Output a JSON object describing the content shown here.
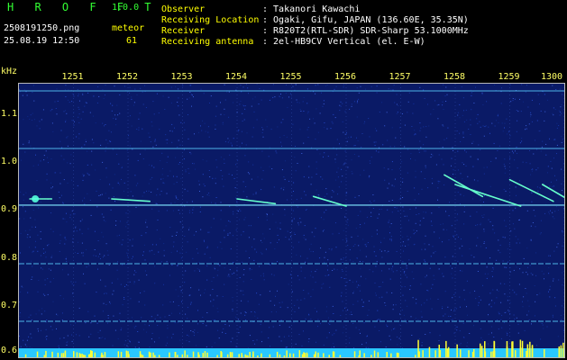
{
  "app": {
    "brand": "H R O F F T",
    "version": "1.0.0"
  },
  "file": {
    "name": "2508191250.png",
    "timestamp": "25.08.19 12:50"
  },
  "detector": {
    "label": "meteor",
    "count": "61"
  },
  "station": [
    {
      "key": "Observer",
      "value": ": Takanori Kawachi"
    },
    {
      "key": "Receiving Location",
      "value": ": Ogaki, Gifu, JAPAN (136.60E, 35.35N)"
    },
    {
      "key": "Receiver",
      "value": ": R820T2(RTL-SDR) SDR-Sharp 53.1000MHz"
    },
    {
      "key": "Receiving antenna",
      "value": ": 2el-HB9CV Vertical (el. E-W)"
    }
  ],
  "colors": {
    "accent": "#33ff33",
    "text": "#ffffff",
    "label": "#ffff00",
    "axis": "#ffff66",
    "background": "#0a1a66",
    "signal": "#44ddff"
  },
  "chart_data": {
    "type": "heatmap",
    "xlabel": "",
    "ylabel": "kHz",
    "x_ticks": [
      "1251",
      "1252",
      "1253",
      "1254",
      "1255",
      "1256",
      "1257",
      "1258",
      "1259",
      "1300"
    ],
    "y_ticks": [
      "1.1",
      "1.0",
      "0.9",
      "0.8",
      "0.7",
      "0.6"
    ],
    "x_range": [
      1250,
      1300
    ],
    "y_range": [
      0.595,
      1.165
    ],
    "carriers_khz": [
      1.15,
      1.03,
      0.912,
      0.79,
      0.67,
      0.61
    ],
    "meteor_traces": [
      {
        "x": [
          1250.2,
          1250.6
        ],
        "y": [
          0.925,
          0.925
        ]
      },
      {
        "x": [
          1251.7,
          1252.4
        ],
        "y": [
          0.925,
          0.92
        ]
      },
      {
        "x": [
          1254.0,
          1254.7
        ],
        "y": [
          0.925,
          0.915
        ]
      },
      {
        "x": [
          1255.4,
          1256.0
        ],
        "y": [
          0.93,
          0.91
        ]
      },
      {
        "x": [
          1257.8,
          1258.5
        ],
        "y": [
          0.975,
          0.93
        ]
      },
      {
        "x": [
          1258.0,
          1259.2
        ],
        "y": [
          0.955,
          0.91
        ]
      },
      {
        "x": [
          1259.0,
          1259.8
        ],
        "y": [
          0.965,
          0.92
        ]
      },
      {
        "x": [
          1259.6,
          1300.2
        ],
        "y": [
          0.955,
          0.915
        ]
      }
    ]
  }
}
